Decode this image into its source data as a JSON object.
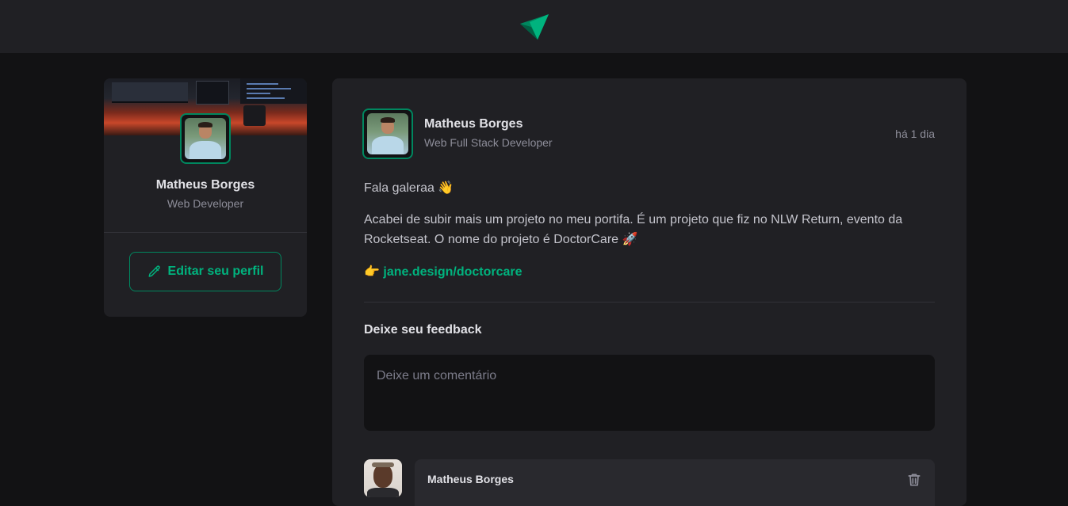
{
  "sidebar": {
    "name": "Matheus Borges",
    "role": "Web Developer",
    "edit_label": "Editar seu perfil"
  },
  "post": {
    "author_name": "Matheus Borges",
    "author_role": "Web Full Stack Developer",
    "time": "há 1 dia",
    "paragraph1": "Fala galeraa 👋",
    "paragraph2": "Acabei de subir mais um projeto no meu portifa. É um projeto que fiz no NLW Return, evento da Rocketseat. O nome do projeto é DoctorCare 🚀",
    "link_emoji": "👉",
    "link_text": "jane.design/doctorcare",
    "feedback_title": "Deixe seu feedback",
    "comment_placeholder": "Deixe um comentário"
  },
  "comment": {
    "author_name": "Matheus Borges"
  },
  "icons": {
    "logo": "ignite-logo",
    "edit": "pencil-icon",
    "trash": "trash-icon"
  },
  "colors": {
    "accent": "#00b37e",
    "accent_dark": "#00875f",
    "background": "#121214",
    "surface": "#202024"
  }
}
